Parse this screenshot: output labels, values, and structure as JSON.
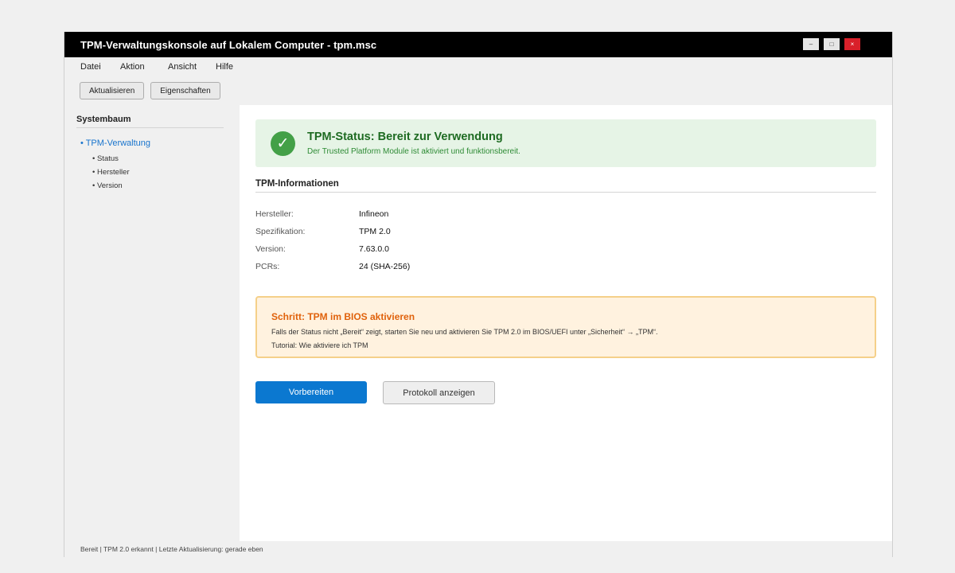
{
  "window": {
    "title": "TPM-Verwaltungskonsole auf Lokalem Computer - tpm.msc",
    "controls": {
      "minimize": "–",
      "maximize": "□",
      "close": "×"
    }
  },
  "menu": [
    "Datei",
    "Aktion",
    "Ansicht",
    "Hilfe"
  ],
  "toolbar": {
    "refresh_label": "Aktualisieren",
    "properties_label": "Eigenschaften"
  },
  "sidebar": {
    "title": "Systembaum",
    "root": "• TPM-Verwaltung",
    "items": [
      "• Status",
      "• Hersteller",
      "• Version"
    ]
  },
  "status": {
    "icon": "✓",
    "title": "TPM-Status: Bereit zur Verwendung",
    "subtitle": "Der Trusted Platform Module ist aktiviert und funktionsbereit."
  },
  "info": {
    "title": "TPM-Informationen",
    "rows": [
      {
        "label": "Hersteller:",
        "value": "Infineon"
      },
      {
        "label": "Spezifikation:",
        "value": "TPM 2.0"
      },
      {
        "label": "Version:",
        "value": "7.63.0.0"
      },
      {
        "label": "PCRs:",
        "value": "24 (SHA-256)"
      }
    ]
  },
  "hint": {
    "title": "Schritt: TPM im BIOS aktivieren",
    "text": "Falls der Status nicht „Bereit“ zeigt, starten Sie neu und aktivieren Sie TPM 2.0 im BIOS/UEFI unter „Sicherheit“ → „TPM“.",
    "link": "Tutorial: Wie aktiviere ich TPM"
  },
  "actions": {
    "prepare_label": "Vorbereiten",
    "log_label": "Protokoll anzeigen"
  },
  "statusbar": "Bereit | TPM 2.0 erkannt | Letzte Aktualisierung: gerade eben",
  "colors": {
    "titlebar": "#000000",
    "success": "#43a047",
    "success_bg": "#e6f4e6",
    "warning_title": "#e0620c",
    "warning_bg": "#fff2df",
    "warning_border": "#f5d089",
    "primary": "#0b78d0",
    "link": "#1874cd",
    "close": "#d9202a"
  }
}
